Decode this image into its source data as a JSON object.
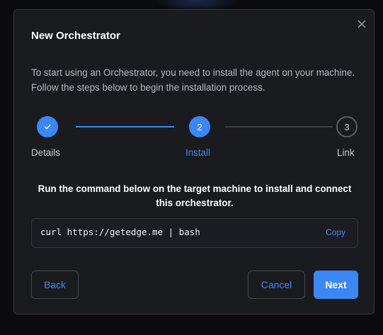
{
  "dialog": {
    "title": "New Orchestrator",
    "close_icon": "close-icon",
    "description": "To start using an Orchestrator, you need to install the agent on your machine. Follow the steps below to begin the installation process."
  },
  "stepper": {
    "steps": [
      {
        "label": "Details",
        "state": "complete",
        "indicator_icon": "checkmark-icon"
      },
      {
        "label": "Install",
        "state": "active",
        "number": "2"
      },
      {
        "label": "Link",
        "state": "pending",
        "number": "3"
      }
    ],
    "colors": {
      "accent": "#3b87f5",
      "inactive": "#5b5c61"
    }
  },
  "install": {
    "instruction": "Run the command below on the target machine to install and connect this orchestrator.",
    "command": "curl https://getedge.me | bash",
    "copy_label": "Copy"
  },
  "footer": {
    "back_label": "Back",
    "cancel_label": "Cancel",
    "next_label": "Next"
  }
}
